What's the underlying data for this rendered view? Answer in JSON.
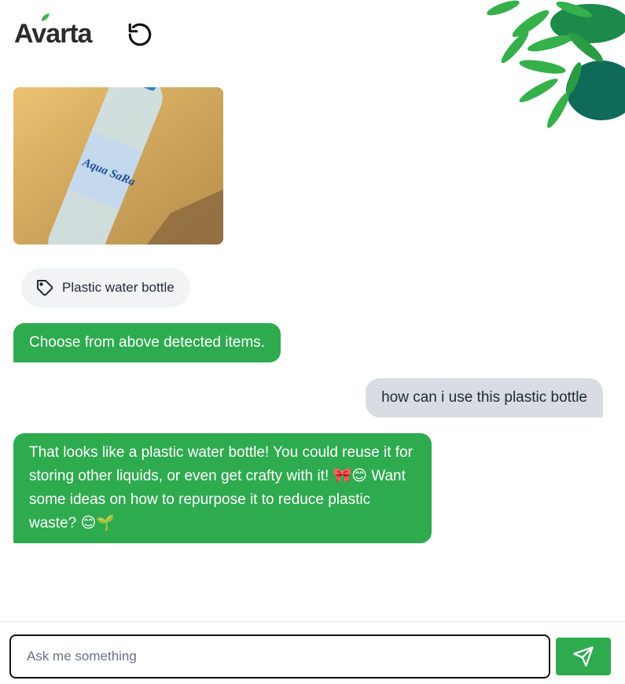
{
  "header": {
    "logo_text": "Avarta",
    "reset_icon": "refresh-ccw-icon"
  },
  "upload": {
    "image_icon": "photo-thumbnail",
    "bottle_text": "Aqua SaRa"
  },
  "detected": {
    "items": [
      {
        "label": "Plastic water bottle",
        "icon": "tag-icon"
      }
    ]
  },
  "messages": [
    {
      "role": "bot",
      "text": "Choose from above detected items."
    },
    {
      "role": "user",
      "text": "how can i use this plastic bottle"
    },
    {
      "role": "bot",
      "text": "That looks like a plastic water bottle! You could reuse it for storing other liquids, or even get crafty with it! 🎀😊 Want some ideas on how to repurpose it to reduce plastic waste? 😊🌱"
    }
  ],
  "composer": {
    "placeholder": "Ask me something",
    "value": "",
    "send_icon": "send-icon"
  },
  "colors": {
    "accent": "#2eaa4f",
    "user_bubble": "#d9dde3",
    "chip": "#f1f3f5"
  }
}
